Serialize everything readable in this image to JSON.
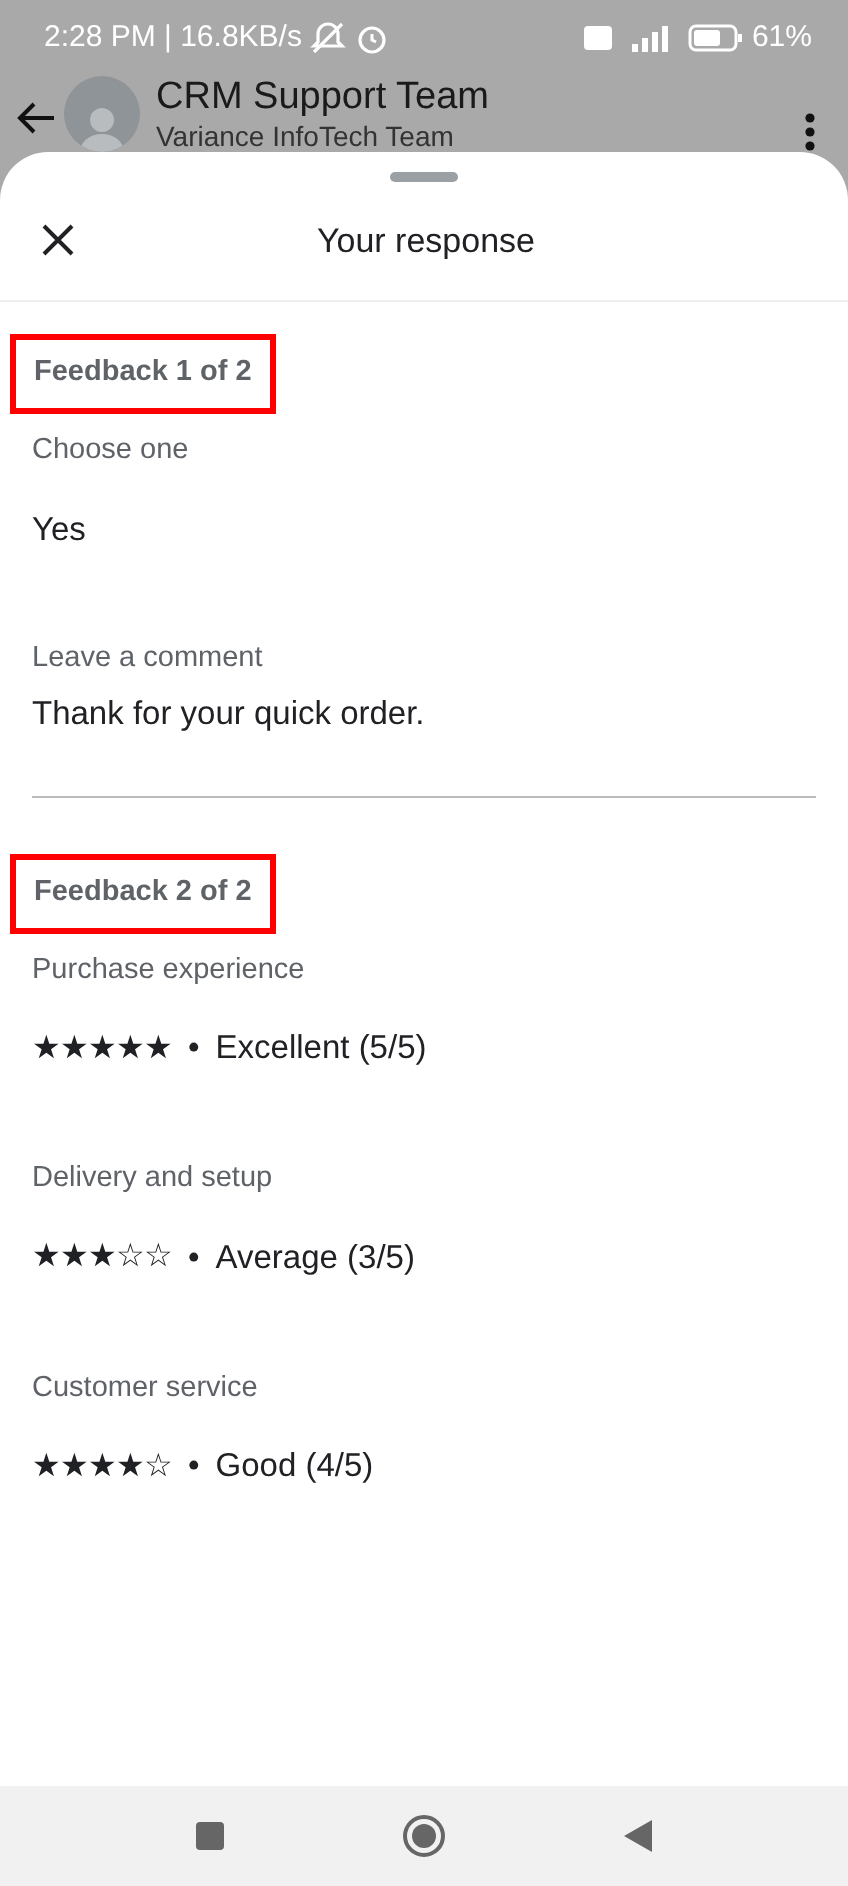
{
  "status_bar": {
    "time": "2:28 PM | 16.8KB/s",
    "battery": "61%"
  },
  "chat_header": {
    "title": "CRM Support Team",
    "subtitle": "Variance InfoTech Team"
  },
  "sheet": {
    "title": "Your response",
    "sections": [
      {
        "heading": "Feedback 1 of 2",
        "highlighted": true,
        "fields": [
          {
            "kind": "text",
            "label": "Choose one",
            "value": "Yes"
          },
          {
            "kind": "comment",
            "label": "Leave a comment",
            "value": "Thank for your quick order."
          }
        ]
      },
      {
        "heading": "Feedback 2 of 2",
        "highlighted": true,
        "fields": [
          {
            "kind": "rating",
            "label": "Purchase experience",
            "stars": 5,
            "separator": "•",
            "value": "Excellent (5/5)"
          },
          {
            "kind": "rating",
            "label": "Delivery and setup",
            "stars": 3,
            "separator": "•",
            "value": "Average (3/5)"
          },
          {
            "kind": "rating",
            "label": "Customer service",
            "stars": 4,
            "separator": "•",
            "value": "Good (4/5)"
          }
        ]
      }
    ]
  }
}
